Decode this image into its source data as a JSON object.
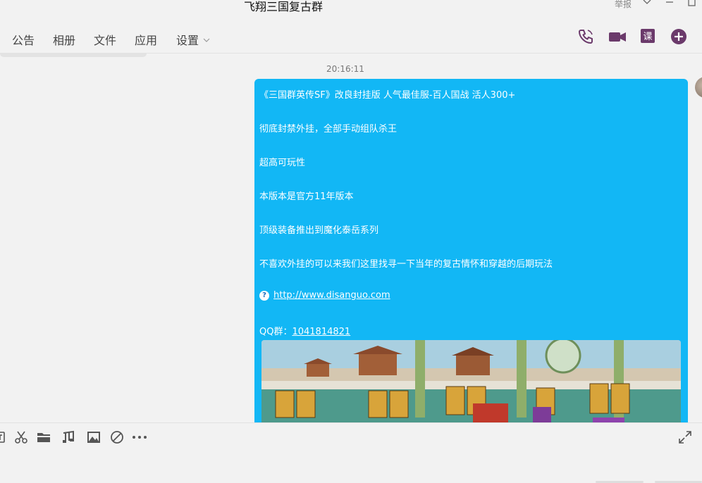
{
  "window": {
    "title": "飞翔三国复古群",
    "report_label": "举报"
  },
  "tabs": [
    {
      "label": "公告"
    },
    {
      "label": "相册"
    },
    {
      "label": "文件"
    },
    {
      "label": "应用"
    },
    {
      "label": "设置"
    }
  ],
  "toolbar_icons": [
    "phone-icon",
    "video-icon",
    "course-icon",
    "add-icon"
  ],
  "chat": {
    "timestamp": "20:16:11",
    "message": {
      "lines": [
        "《三国群英传SF》改良封挂版 人气最佳服-百人国战 活人300+",
        "彻底封禁外挂，全部手动组队杀王",
        "超高可玩性",
        "本版本是官方11年版本",
        "顶级装备推出到魔化泰岳系列",
        "不喜欢外挂的可以来我们这里找寻一下当年的复古情怀和穿越的后期玩法"
      ],
      "url": "http://www.disanguo.com",
      "qq_label": "QQ群：",
      "qq_number": "1041814821"
    },
    "bubble_color": "#12b7f5"
  },
  "input_toolbar_icons": [
    "font-icon",
    "scissors-icon",
    "folder-icon",
    "music-icon",
    "image-icon",
    "block-icon",
    "more-icon",
    "expand-icon"
  ]
}
